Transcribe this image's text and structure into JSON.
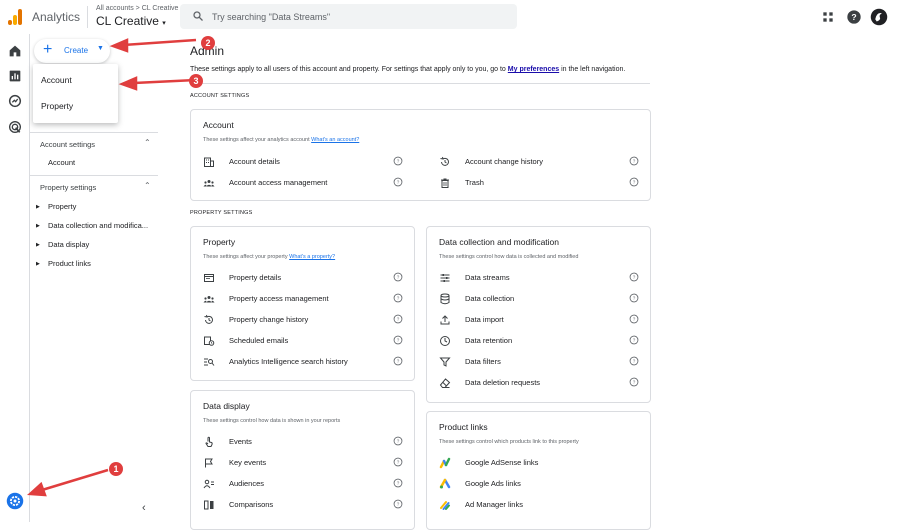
{
  "header": {
    "app_title": "Analytics",
    "account_crumb": "All accounts > CL Creative",
    "account_name": "CL Creative",
    "search_placeholder": "Try searching \"Data Streams\""
  },
  "create": {
    "label": "Create",
    "menu": [
      "Account",
      "Property"
    ]
  },
  "sidenav": {
    "account_settings": {
      "label": "Account settings",
      "items": [
        "Account"
      ]
    },
    "property_settings": {
      "label": "Property settings",
      "items": [
        "Property",
        "Data collection and modifica...",
        "Data display",
        "Product links"
      ]
    }
  },
  "main": {
    "title": "Admin",
    "desc_before": "These settings apply to all users of this account and property. For settings that apply only to you, go to ",
    "desc_link": "My preferences",
    "desc_after": " in the left navigation.",
    "account_section_label": "ACCOUNT SETTINGS",
    "property_section_label": "PROPERTY SETTINGS"
  },
  "cards": {
    "account": {
      "title": "Account",
      "sub": "These settings affect your analytics account",
      "sub_link": "What's an account?",
      "left": [
        {
          "label": "Account details",
          "icon": "building-icon"
        },
        {
          "label": "Account access management",
          "icon": "people-icon"
        }
      ],
      "right": [
        {
          "label": "Account change history",
          "icon": "history-icon"
        },
        {
          "label": "Trash",
          "icon": "trash-icon"
        }
      ]
    },
    "property": {
      "title": "Property",
      "sub": "These settings affect your property",
      "sub_link": "What's a property?",
      "rows": [
        {
          "label": "Property details",
          "icon": "card-icon"
        },
        {
          "label": "Property access management",
          "icon": "people-icon"
        },
        {
          "label": "Property change history",
          "icon": "history-icon"
        },
        {
          "label": "Scheduled emails",
          "icon": "email-schedule-icon"
        },
        {
          "label": "Analytics Intelligence search history",
          "icon": "search-list-icon"
        }
      ]
    },
    "data_collection": {
      "title": "Data collection and modification",
      "sub": "These settings control how data is collected and modified",
      "rows": [
        {
          "label": "Data streams",
          "icon": "streams-icon"
        },
        {
          "label": "Data collection",
          "icon": "database-icon"
        },
        {
          "label": "Data import",
          "icon": "upload-icon"
        },
        {
          "label": "Data retention",
          "icon": "retention-icon"
        },
        {
          "label": "Data filters",
          "icon": "filter-icon"
        },
        {
          "label": "Data deletion requests",
          "icon": "eraser-icon"
        }
      ]
    },
    "data_display": {
      "title": "Data display",
      "sub": "These settings control how data is shown in your reports",
      "rows": [
        {
          "label": "Events",
          "icon": "touch-icon"
        },
        {
          "label": "Key events",
          "icon": "flag-icon"
        },
        {
          "label": "Audiences",
          "icon": "audience-icon"
        },
        {
          "label": "Comparisons",
          "icon": "compare-icon"
        }
      ]
    },
    "product_links": {
      "title": "Product links",
      "sub": "These settings control which products link to this property",
      "rows": [
        {
          "label": "Google AdSense links",
          "icon": "adsense-icon"
        },
        {
          "label": "Google Ads links",
          "icon": "google-ads-icon"
        },
        {
          "label": "Ad Manager links",
          "icon": "ad-manager-icon"
        }
      ]
    }
  },
  "annotations": [
    "1",
    "2",
    "3"
  ],
  "colors": {
    "accent": "#1a73e8",
    "annotation": "#e03e3e"
  }
}
